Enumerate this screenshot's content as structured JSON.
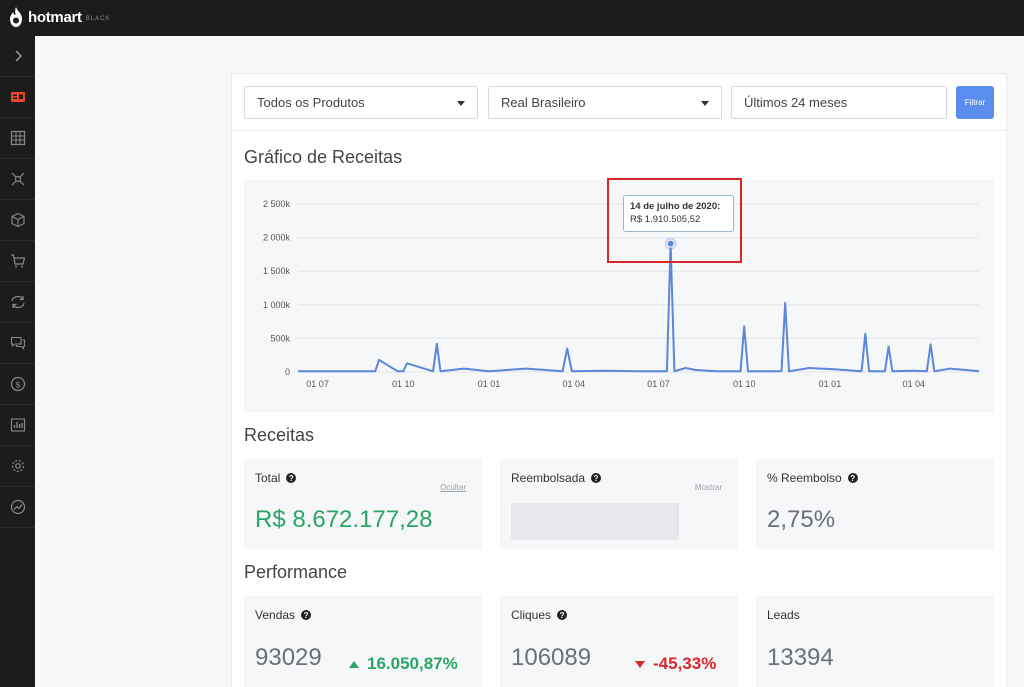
{
  "brand": {
    "name": "hotmart",
    "tier": "BLACK"
  },
  "sidebar": {
    "items": [
      {
        "icon": "chevron-right-icon"
      },
      {
        "icon": "dashboard-icon",
        "active": true
      },
      {
        "icon": "grid-icon"
      },
      {
        "icon": "network-icon"
      },
      {
        "icon": "box-icon"
      },
      {
        "icon": "cart-icon"
      },
      {
        "icon": "refresh-icon"
      },
      {
        "icon": "chat-icon"
      },
      {
        "icon": "dollar-icon"
      },
      {
        "icon": "bar-chart-icon"
      },
      {
        "icon": "gear-icon"
      },
      {
        "icon": "trend-icon"
      }
    ]
  },
  "filters": {
    "product": "Todos os Produtos",
    "currency": "Real Brasileiro",
    "period": "Últimos 24 meses",
    "submit_label": "Filtrar"
  },
  "chart_section": {
    "title": "Gráfico de Receitas"
  },
  "chart_data": {
    "type": "line",
    "title": "",
    "xlabel": "",
    "ylabel": "",
    "ylim": [
      0,
      2500000
    ],
    "yticks": [
      "0",
      "500k",
      "1 000k",
      "1 500k",
      "2 000k",
      "2 500k"
    ],
    "ytick_values": [
      0,
      500000,
      1000000,
      1500000,
      2000000,
      2500000
    ],
    "xticks": [
      "01 07",
      "01 10",
      "01 01",
      "01 04",
      "01 07",
      "01 10",
      "01 01",
      "01 04"
    ],
    "xtick_dates": [
      "2019-07-01",
      "2019-10-01",
      "2020-01-01",
      "2020-04-01",
      "2020-07-01",
      "2020-10-01",
      "2021-01-01",
      "2021-04-01"
    ],
    "xlim": [
      "2019-06-10",
      "2021-06-10"
    ],
    "grid": true,
    "color": "#5b86d9",
    "series": [
      {
        "x": [
          "2019-06-10",
          "2019-09-01",
          "2019-09-05",
          "2019-09-25",
          "2019-10-01",
          "2019-10-05",
          "2019-11-02",
          "2019-11-06",
          "2019-11-10",
          "2019-12-05",
          "2020-01-01",
          "2020-02-10",
          "2020-03-20",
          "2020-03-25",
          "2020-03-30",
          "2020-05-05",
          "2020-06-10",
          "2020-07-10",
          "2020-07-14",
          "2020-07-18",
          "2020-07-30",
          "2020-08-10",
          "2020-09-01",
          "2020-09-27",
          "2020-10-01",
          "2020-10-05",
          "2020-11-10",
          "2020-11-14",
          "2020-11-18",
          "2020-12-10",
          "2021-01-05",
          "2021-02-04",
          "2021-02-08",
          "2021-02-12",
          "2021-03-01",
          "2021-03-05",
          "2021-03-09",
          "2021-04-01",
          "2021-04-15",
          "2021-04-19",
          "2021-04-23",
          "2021-05-10",
          "2021-06-05",
          "2021-06-10"
        ],
        "y": [
          10000,
          10000,
          180000,
          10000,
          10000,
          130000,
          10000,
          420000,
          10000,
          50000,
          10000,
          50000,
          10000,
          350000,
          10000,
          20000,
          10000,
          10000,
          1910505.52,
          10000,
          60000,
          30000,
          10000,
          10000,
          680000,
          10000,
          10000,
          1030000,
          10000,
          60000,
          40000,
          10000,
          570000,
          10000,
          10000,
          380000,
          10000,
          20000,
          10000,
          410000,
          10000,
          50000,
          20000,
          10000
        ]
      }
    ],
    "tooltip": {
      "date": "14 de julho de 2020:",
      "value": "R$ 1.910.505,52"
    }
  },
  "revenue": {
    "title": "Receitas",
    "total": {
      "label": "Total",
      "action": "Ocultar",
      "value": "R$ 8.672.177,28",
      "value_color": "#2aa565"
    },
    "refunded": {
      "label": "Reembolsada",
      "action": "Mostrar"
    },
    "refund_rate": {
      "label": "% Reembolso",
      "value": "2,75%"
    }
  },
  "performance": {
    "title": "Performance",
    "sales": {
      "label": "Vendas",
      "value": "93029",
      "delta": "16.050,87%",
      "trend": "up"
    },
    "clicks": {
      "label": "Cliques",
      "value": "106089",
      "delta": "-45,33%",
      "trend": "down"
    },
    "leads": {
      "label": "Leads",
      "value": "13394"
    }
  },
  "colors": {
    "accent": "#5b8def",
    "positive": "#2aa565",
    "negative": "#d9262b",
    "highlight_box": "#d9262b"
  }
}
